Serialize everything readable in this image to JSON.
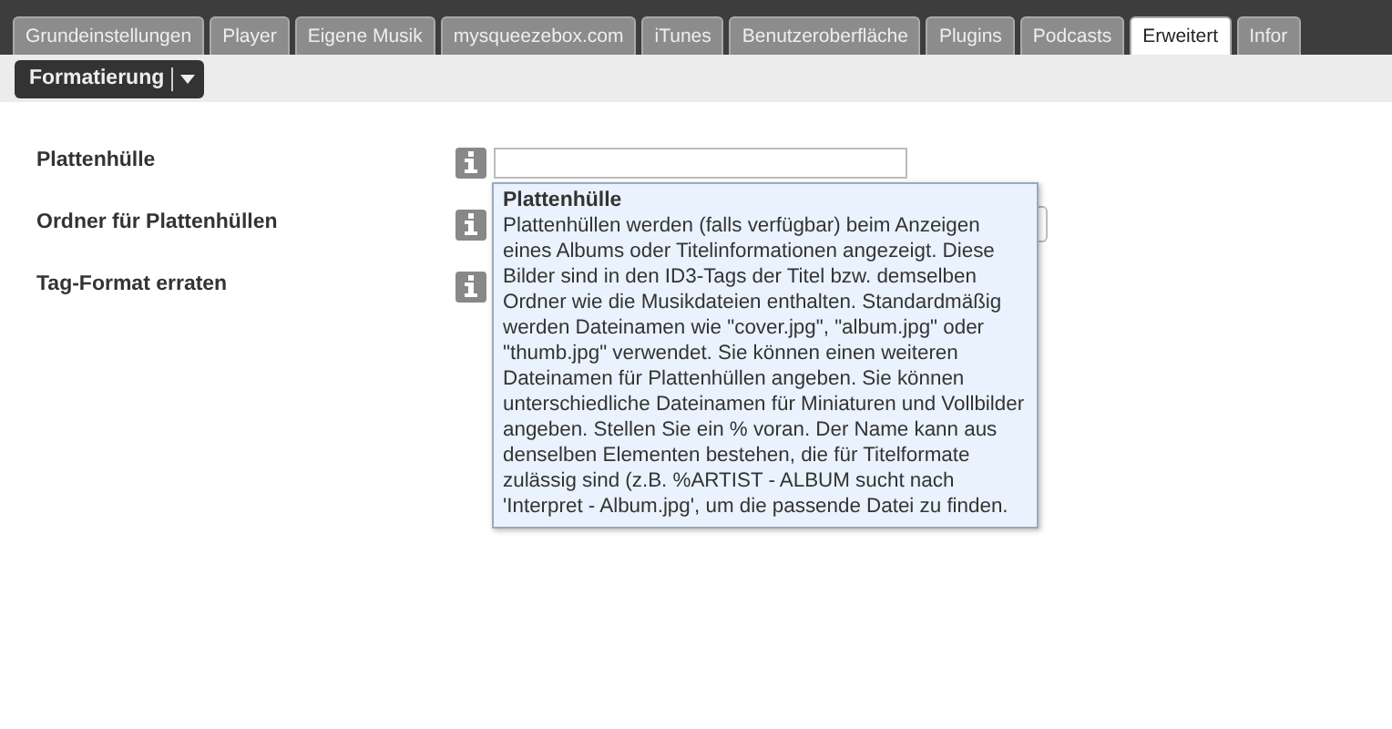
{
  "tabs": [
    {
      "label": "Grundeinstellungen",
      "selected": false
    },
    {
      "label": "Player",
      "selected": false
    },
    {
      "label": "Eigene Musik",
      "selected": false
    },
    {
      "label": "mysqueezebox.com",
      "selected": false
    },
    {
      "label": "iTunes",
      "selected": false
    },
    {
      "label": "Benutzeroberfläche",
      "selected": false
    },
    {
      "label": "Plugins",
      "selected": false
    },
    {
      "label": "Podcasts",
      "selected": false
    },
    {
      "label": "Erweitert",
      "selected": true
    },
    {
      "label": "Infor",
      "selected": false
    }
  ],
  "toolbar": {
    "menu_button": "Formatierung"
  },
  "settings": [
    {
      "label": "Plattenhülle",
      "kind": "field"
    },
    {
      "label": "Ordner für Plattenhüllen",
      "kind": "field"
    },
    {
      "label": "Tag-Format erraten",
      "kind": "plain"
    }
  ],
  "tooltip": {
    "title": "Plattenhülle",
    "text": "Plattenhüllen werden (falls verfügbar) beim Anzeigen eines Albums oder Titelinformationen angezeigt. Diese Bilder sind in den ID3-Tags der Titel bzw. demselben Ordner wie die Musikdateien enthalten. Standardmäßig werden Dateinamen wie \"cover.jpg\", \"album.jpg\" oder \"thumb.jpg\" verwendet. Sie können einen weiteren Dateinamen für Plattenhüllen angeben. Sie können unterschiedliche Dateinamen für Miniaturen und Vollbilder angeben. Stellen Sie ein % voran. Der Name kann aus denselben Elementen bestehen, die für Titelformate zulässig sind (z.B. %ARTIST - ALBUM sucht nach 'Interpret - Album.jpg', um die passende Datei zu finden."
  }
}
